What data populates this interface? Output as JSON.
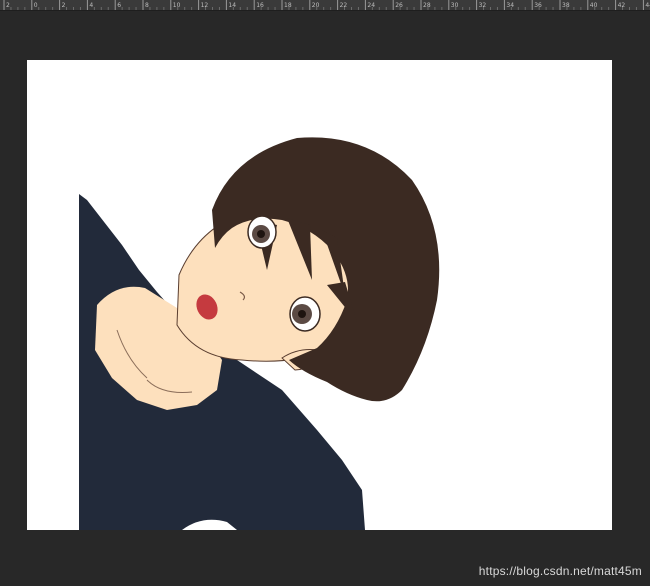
{
  "ruler": {
    "labels": [
      "2",
      "0",
      "2",
      "4",
      "6",
      "8",
      "10",
      "12",
      "14",
      "16",
      "18",
      "20",
      "22",
      "24",
      "26",
      "28",
      "30",
      "32",
      "34",
      "36",
      "38",
      "40",
      "42",
      "44"
    ]
  },
  "colors": {
    "workspace": "#282828",
    "ruler": "#3a3a3a",
    "canvas": "#ffffff",
    "hair": "#3b2a22",
    "skin": "#fde0bd",
    "shirt": "#222a3a",
    "mouth": "#c53a3f"
  },
  "watermark": "https://blog.csdn.net/matt45m"
}
